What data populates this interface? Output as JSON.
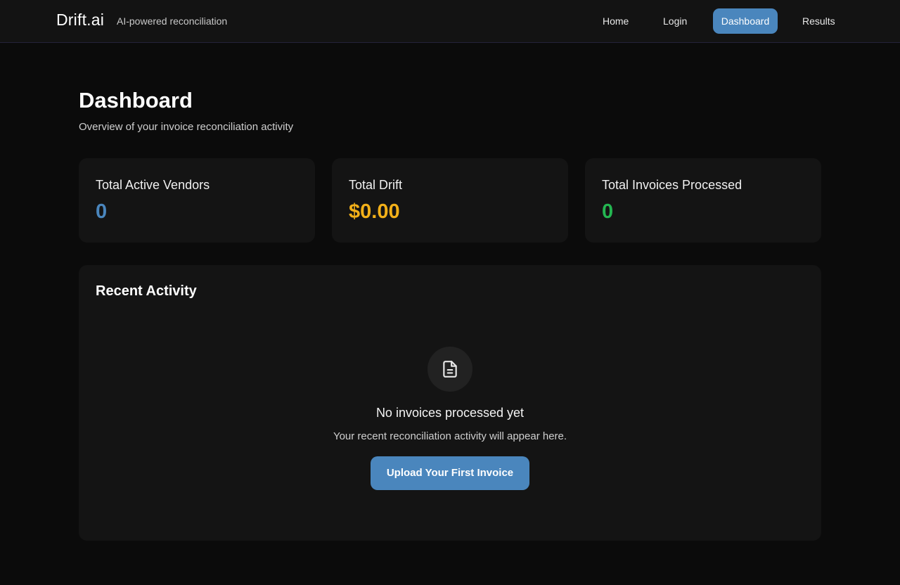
{
  "header": {
    "brand": "Drift.ai",
    "tagline": "AI-powered reconciliation",
    "nav": {
      "home": "Home",
      "login": "Login",
      "dashboard": "Dashboard",
      "results": "Results"
    },
    "active_nav": "Dashboard",
    "accent_color": "#4a86bd"
  },
  "page": {
    "title": "Dashboard",
    "subtitle": "Overview of your invoice reconciliation activity"
  },
  "stats": [
    {
      "label": "Total Active Vendors",
      "value": "0",
      "color": "#4a86bd"
    },
    {
      "label": "Total Drift",
      "value": "$0.00",
      "color": "#f2b019"
    },
    {
      "label": "Total Invoices Processed",
      "value": "0",
      "color": "#24b651"
    }
  ],
  "activity": {
    "title": "Recent Activity",
    "empty_icon": "document-icon",
    "empty_title": "No invoices processed yet",
    "empty_text": "Your recent reconciliation activity will appear here.",
    "upload_button": "Upload Your First Invoice"
  }
}
